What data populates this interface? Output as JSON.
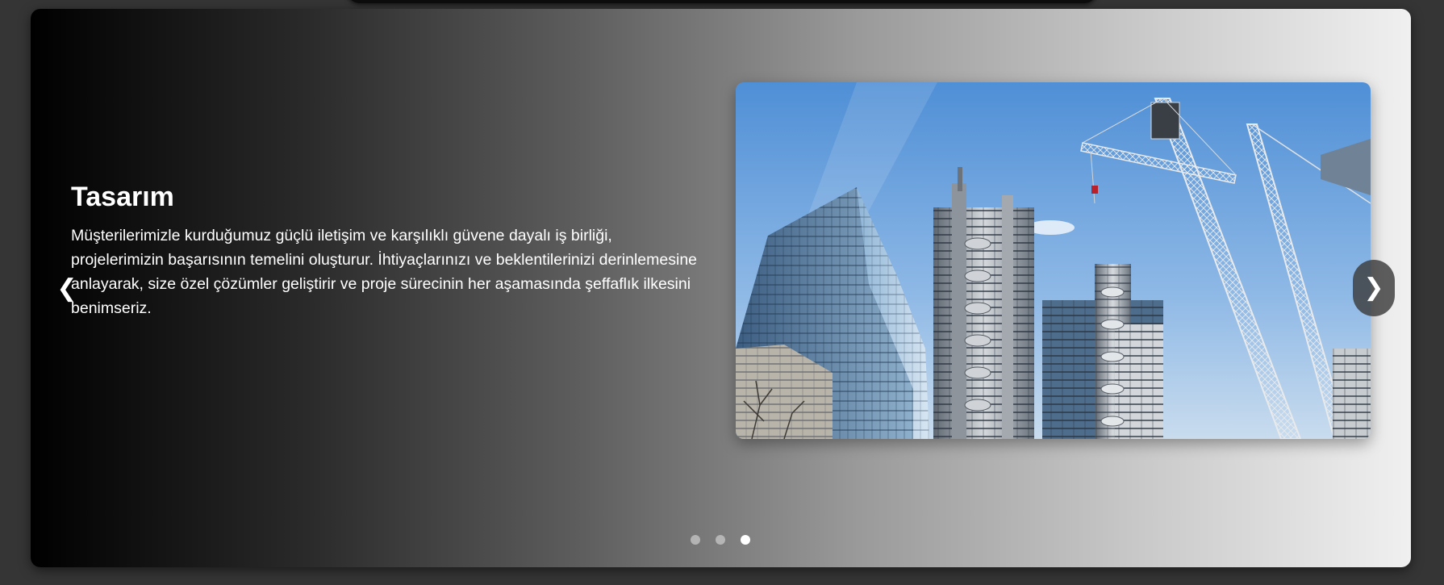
{
  "slider": {
    "slide": {
      "title": "Tasarım",
      "description": "Müşterilerimizle kurduğumuz güçlü iletişim ve karşılıklı güvene dayalı iş birliği, projelerimizin başarısının temelini oluşturur. İhtiyaçlarınızı ve beklentilerinizi derinlemesine anlayarak, size özel çözümler geliştirir ve proje sürecinin her aşamasında şeffaflık ilkesini benimseriz.",
      "image": "skyscrapers-construction-cranes-photo"
    },
    "nav": {
      "prev_glyph": "❮",
      "next_glyph": "❯"
    },
    "dots": {
      "count": 3,
      "active_index": 2
    }
  },
  "colors": {
    "page_background": "#353535",
    "gradient_start": "#000000",
    "gradient_end": "#f0f0f0",
    "text": "#ffffff"
  }
}
